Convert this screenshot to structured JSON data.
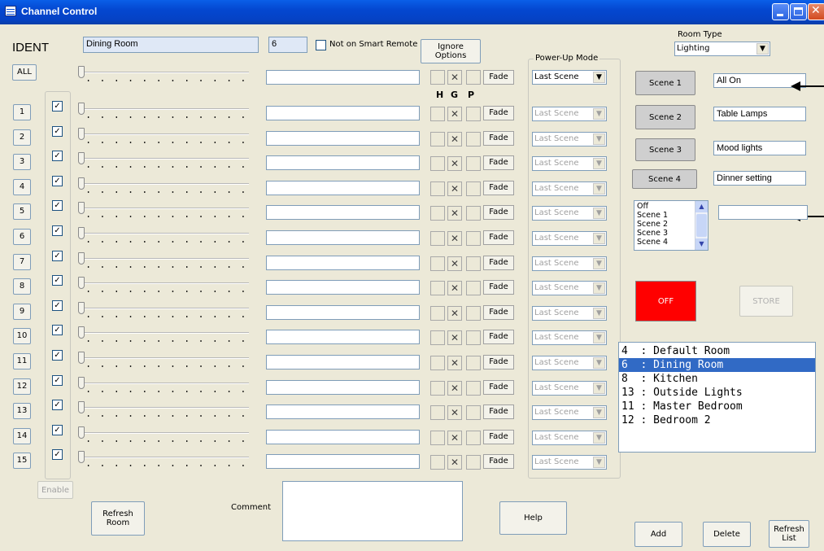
{
  "window": {
    "title": "Channel Control"
  },
  "header": {
    "ident_label": "IDENT",
    "room_name": "Dining Room",
    "room_number": "6",
    "not_on_remote_label": "Not on Smart Remote",
    "ignore_options_label": "Ignore\nOptions",
    "power_up_label": "Power-Up Mode",
    "hgp": [
      "H",
      "G",
      "P"
    ],
    "room_type_label": "Room Type",
    "room_type_value": "Lighting"
  },
  "all_row": {
    "label": "ALL",
    "fade": "Fade",
    "mode": "Last Scene"
  },
  "channels": [
    {
      "num": "1",
      "fade": "Fade",
      "mode": "Last Scene"
    },
    {
      "num": "2",
      "fade": "Fade",
      "mode": "Last Scene"
    },
    {
      "num": "3",
      "fade": "Fade",
      "mode": "Last Scene"
    },
    {
      "num": "4",
      "fade": "Fade",
      "mode": "Last Scene"
    },
    {
      "num": "5",
      "fade": "Fade",
      "mode": "Last Scene"
    },
    {
      "num": "6",
      "fade": "Fade",
      "mode": "Last Scene"
    },
    {
      "num": "7",
      "fade": "Fade",
      "mode": "Last Scene"
    },
    {
      "num": "8",
      "fade": "Fade",
      "mode": "Last Scene"
    },
    {
      "num": "9",
      "fade": "Fade",
      "mode": "Last Scene"
    },
    {
      "num": "10",
      "fade": "Fade",
      "mode": "Last Scene"
    },
    {
      "num": "11",
      "fade": "Fade",
      "mode": "Last Scene"
    },
    {
      "num": "12",
      "fade": "Fade",
      "mode": "Last Scene"
    },
    {
      "num": "13",
      "fade": "Fade",
      "mode": "Last Scene"
    },
    {
      "num": "14",
      "fade": "Fade",
      "mode": "Last Scene"
    },
    {
      "num": "15",
      "fade": "Fade",
      "mode": "Last Scene"
    }
  ],
  "enable_label": "Enable",
  "scenes": [
    {
      "button": "Scene 1",
      "name": "All On"
    },
    {
      "button": "Scene 2",
      "name": "Table Lamps"
    },
    {
      "button": "Scene 3",
      "name": "Mood lights"
    },
    {
      "button": "Scene 4",
      "name": "Dinner setting"
    }
  ],
  "scene_list": [
    "Off",
    "Scene 1",
    "Scene 2",
    "Scene 3",
    "Scene 4"
  ],
  "off_button": "OFF",
  "store_button": "STORE",
  "rooms": [
    {
      "num": "4",
      "name": "Default Room"
    },
    {
      "num": "6",
      "name": "Dining Room",
      "selected": true
    },
    {
      "num": "8",
      "name": "Kitchen"
    },
    {
      "num": "13",
      "name": "Outside Lights"
    },
    {
      "num": "11",
      "name": "Master Bedroom"
    },
    {
      "num": "12",
      "name": "Bedroom 2"
    }
  ],
  "bottom": {
    "refresh_room": "Refresh\nRoom",
    "comment_label": "Comment",
    "help": "Help",
    "add": "Add",
    "delete": "Delete",
    "refresh_list": "Refresh\nList"
  },
  "colors": {
    "off_button": "#ff0000",
    "selection": "#316ac5",
    "title_bar": "#0542c5"
  }
}
